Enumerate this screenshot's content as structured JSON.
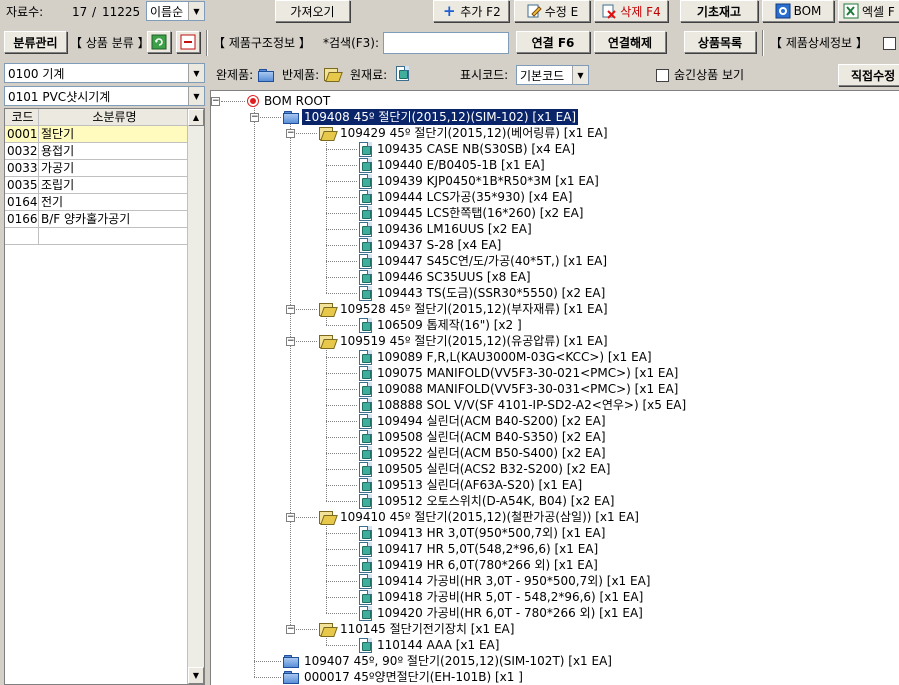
{
  "toolbar1": {
    "record_label": "자료수:",
    "record_current": "17",
    "record_sep": "/",
    "record_total": "11225",
    "sort_value": "이름순",
    "fetch_label": "가져오기",
    "add_label": "추가 F2",
    "edit_label": "수정 E",
    "delete_label": "삭제 F4",
    "base_stock_label": "기초재고",
    "bom_label": "BOM",
    "excel_label": "엑셀 F"
  },
  "toolbar2": {
    "category_manage_label": "분류관리",
    "category_title": "【 상품 분류 】",
    "structure_title": "【 제품구조정보 】",
    "search_label": "*검색(F3):",
    "search_value": "",
    "link_label": "연결 F6",
    "unlink_label": "연결해제",
    "product_list_label": "상품목록",
    "detail_title": "【 제품상세정보 】"
  },
  "left": {
    "major_value": "0100 기계",
    "minor_value": "0101 PVC샷시기계",
    "grid_headers": [
      "코드",
      "소분류명"
    ],
    "rows": [
      {
        "code": "0001",
        "name": "절단기"
      },
      {
        "code": "0032",
        "name": "용접기"
      },
      {
        "code": "0033",
        "name": "가공기"
      },
      {
        "code": "0035",
        "name": "조립기"
      },
      {
        "code": "0164",
        "name": "전기"
      },
      {
        "code": "0166",
        "name": "B/F 양카홀가공기"
      }
    ]
  },
  "legend": {
    "finished_label": "완제품:",
    "semi_label": "반제품:",
    "raw_label": "원재료:",
    "display_code_label": "표시코드:",
    "display_code_value": "기본코드",
    "hidden_label": "숨긴상품 보기",
    "direct_edit_label": "직접수정"
  },
  "tree": [
    {
      "depth": 0,
      "icon": "root",
      "text": "BOM ROOT",
      "expander": "minus"
    },
    {
      "depth": 1,
      "icon": "folder-closed",
      "text": "109408 45º 절단기(2015,12)(SIM-102) [x1 EA]",
      "expander": "minus",
      "selected": true
    },
    {
      "depth": 2,
      "icon": "folder-open",
      "text": "109429 45º 절단기(2015,12)(베어링류) [x1 EA]",
      "expander": "minus"
    },
    {
      "depth": 3,
      "icon": "doc",
      "text": "109435 CASE NB(S30SB) [x4 EA]"
    },
    {
      "depth": 3,
      "icon": "doc",
      "text": "109440 E/B0405-1B [x1 EA]"
    },
    {
      "depth": 3,
      "icon": "doc",
      "text": "109439 KJP0450*1B*R50*3M [x1 EA]"
    },
    {
      "depth": 3,
      "icon": "doc",
      "text": "109444 LCS가공(35*930) [x4 EA]"
    },
    {
      "depth": 3,
      "icon": "doc",
      "text": "109445 LCS한쪽탭(16*260) [x2 EA]"
    },
    {
      "depth": 3,
      "icon": "doc",
      "text": "109436 LM16UUS [x2 EA]"
    },
    {
      "depth": 3,
      "icon": "doc",
      "text": "109437 S-28 [x4 EA]"
    },
    {
      "depth": 3,
      "icon": "doc",
      "text": "109447 S45C연/도/가공(40*5T,) [x1 EA]"
    },
    {
      "depth": 3,
      "icon": "doc",
      "text": "109446 SC35UUS [x8 EA]"
    },
    {
      "depth": 3,
      "icon": "doc",
      "text": "109443 TS(도금)(SSR30*5550) [x2 EA]"
    },
    {
      "depth": 2,
      "icon": "folder-open",
      "text": "109528 45º 절단기(2015,12)(부자재류) [x1 EA]",
      "expander": "minus"
    },
    {
      "depth": 3,
      "icon": "doc",
      "text": "106509 톱제작(16\") [x2 ]"
    },
    {
      "depth": 2,
      "icon": "folder-open",
      "text": "109519 45º 절단기(2015,12)(유공압류) [x1 EA]",
      "expander": "minus"
    },
    {
      "depth": 3,
      "icon": "doc",
      "text": "109089 F,R,L(KAU3000M-03G<KCC>) [x1 EA]"
    },
    {
      "depth": 3,
      "icon": "doc",
      "text": "109075 MANIFOLD(VV5F3-30-021<PMC>) [x1 EA]"
    },
    {
      "depth": 3,
      "icon": "doc",
      "text": "109088 MANIFOLD(VV5F3-30-031<PMC>) [x1 EA]"
    },
    {
      "depth": 3,
      "icon": "doc",
      "text": "108888 SOL V/V(SF 4101-IP-SD2-A2<연우>) [x5 EA]"
    },
    {
      "depth": 3,
      "icon": "doc",
      "text": "109494 실린더(ACM B40-S200) [x2 EA]"
    },
    {
      "depth": 3,
      "icon": "doc",
      "text": "109508 실린더(ACM B40-S350) [x2 EA]"
    },
    {
      "depth": 3,
      "icon": "doc",
      "text": "109522 실린더(ACM B50-S400) [x2 EA]"
    },
    {
      "depth": 3,
      "icon": "doc",
      "text": "109505 실린더(ACS2 B32-S200) [x2 EA]"
    },
    {
      "depth": 3,
      "icon": "doc",
      "text": "109513 실린더(AF63A-S20) [x1 EA]"
    },
    {
      "depth": 3,
      "icon": "doc",
      "text": "109512 오토스위치(D-A54K, B04) [x2 EA]"
    },
    {
      "depth": 2,
      "icon": "folder-open",
      "text": "109410 45º 절단기(2015,12)(철판가공(삼일)) [x1 EA]",
      "expander": "minus"
    },
    {
      "depth": 3,
      "icon": "doc",
      "text": "109413 HR 3,0T(950*500,7외) [x1 EA]"
    },
    {
      "depth": 3,
      "icon": "doc",
      "text": "109417 HR 5,0T(548,2*96,6) [x1 EA]"
    },
    {
      "depth": 3,
      "icon": "doc",
      "text": "109419 HR 6,0T(780*266 외) [x1 EA]"
    },
    {
      "depth": 3,
      "icon": "doc",
      "text": "109414 가공비(HR 3,0T - 950*500,7외) [x1 EA]"
    },
    {
      "depth": 3,
      "icon": "doc",
      "text": "109418 가공비(HR 5,0T - 548,2*96,6) [x1 EA]"
    },
    {
      "depth": 3,
      "icon": "doc",
      "text": "109420 가공비(HR 6,0T - 780*266 외) [x1 EA]"
    },
    {
      "depth": 2,
      "icon": "folder-open",
      "text": "110145 절단기전기장치 [x1 EA]",
      "expander": "minus"
    },
    {
      "depth": 3,
      "icon": "doc",
      "text": "110144 AAA [x1 EA]"
    },
    {
      "depth": 1,
      "icon": "folder-closed",
      "text": "109407 45º, 90º 절단기(2015,12)(SIM-102T) [x1 EA]"
    },
    {
      "depth": 1,
      "icon": "folder-closed",
      "text": "000017 45º양면절단기(EH-101B) [x1 ]"
    }
  ],
  "colors": {
    "window_bg": "#d4d0c8",
    "selection_bg": "#0a246a",
    "grid_selected_bg": "#fffbbf"
  }
}
